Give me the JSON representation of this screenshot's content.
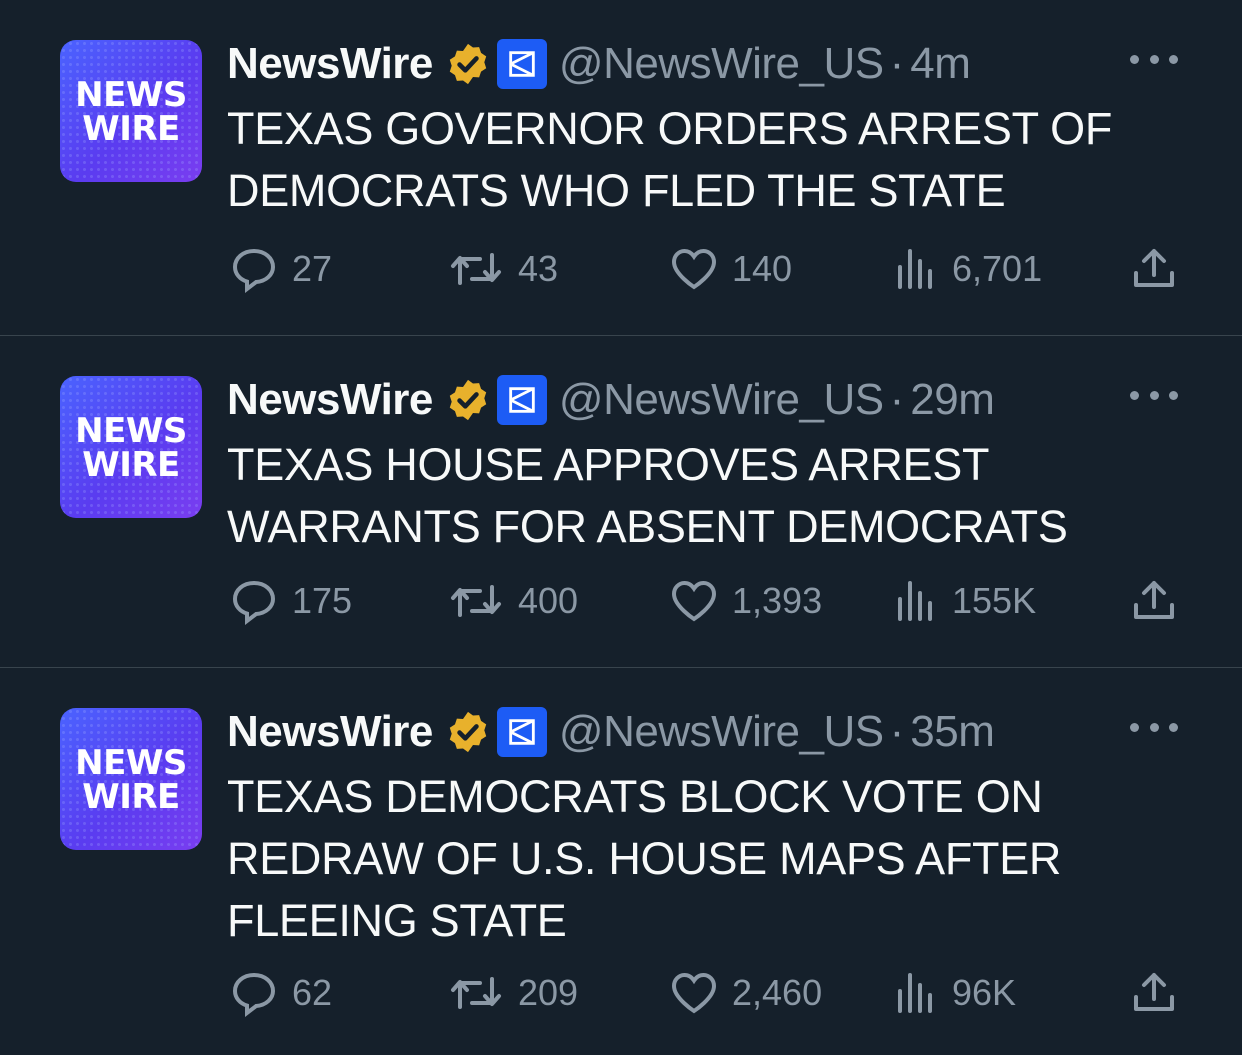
{
  "colors": {
    "background": "#15202b",
    "text": "#f7f9f9",
    "muted": "#8b98a5",
    "divider": "#38444d",
    "verified_gold": "#e8b12c",
    "affiliate_blue": "#1d5cf5"
  },
  "tweets": [
    {
      "avatar_text_1": "NEWS",
      "avatar_text_2": "WIRE",
      "name": "NewsWire",
      "handle": "@NewsWire_US",
      "separator": "·",
      "time": "4m",
      "text": "TEXAS GOVERNOR ORDERS ARREST OF DEMOCRATS WHO FLED THE STATE",
      "replies": "27",
      "retweets": "43",
      "likes": "140",
      "views": "6,701"
    },
    {
      "avatar_text_1": "NEWS",
      "avatar_text_2": "WIRE",
      "name": "NewsWire",
      "handle": "@NewsWire_US",
      "separator": "·",
      "time": "29m",
      "text": "TEXAS HOUSE APPROVES ARREST WARRANTS FOR ABSENT DEMOCRATS",
      "replies": "175",
      "retweets": "400",
      "likes": "1,393",
      "views": "155K"
    },
    {
      "avatar_text_1": "NEWS",
      "avatar_text_2": "WIRE",
      "name": "NewsWire",
      "handle": "@NewsWire_US",
      "separator": "·",
      "time": "35m",
      "text": "TEXAS DEMOCRATS BLOCK VOTE ON REDRAW OF U.S. HOUSE MAPS AFTER FLEEING STATE",
      "replies": "62",
      "retweets": "209",
      "likes": "2,460",
      "views": "96K"
    }
  ],
  "icons": {
    "verified": "verified-badge-icon",
    "affiliate": "affiliate-badge-icon",
    "more": "more-options-icon",
    "reply": "reply-icon",
    "retweet": "retweet-icon",
    "like": "heart-icon",
    "views": "views-chart-icon",
    "share": "share-icon"
  }
}
